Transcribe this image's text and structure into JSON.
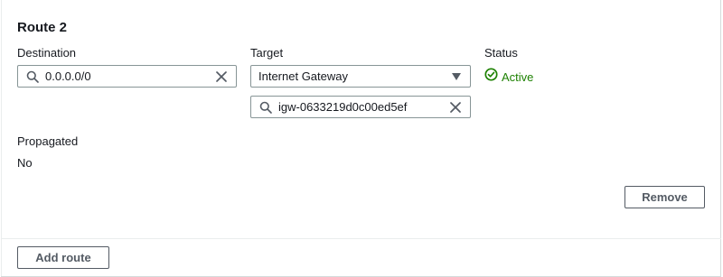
{
  "route": {
    "title": "Route 2",
    "destination": {
      "label": "Destination",
      "value": "0.0.0.0/0"
    },
    "target": {
      "label": "Target",
      "selected": "Internet Gateway",
      "search_value": "igw-0633219d0c00ed5ef"
    },
    "status": {
      "label": "Status",
      "value": "Active",
      "color": "#1d8102"
    },
    "propagated": {
      "label": "Propagated",
      "value": "No"
    },
    "remove_label": "Remove"
  },
  "footer": {
    "add_route_label": "Add route"
  },
  "icons": {
    "search": "search-icon",
    "clear": "close-icon",
    "caret": "caret-down-icon",
    "status": "check-circle-icon"
  }
}
